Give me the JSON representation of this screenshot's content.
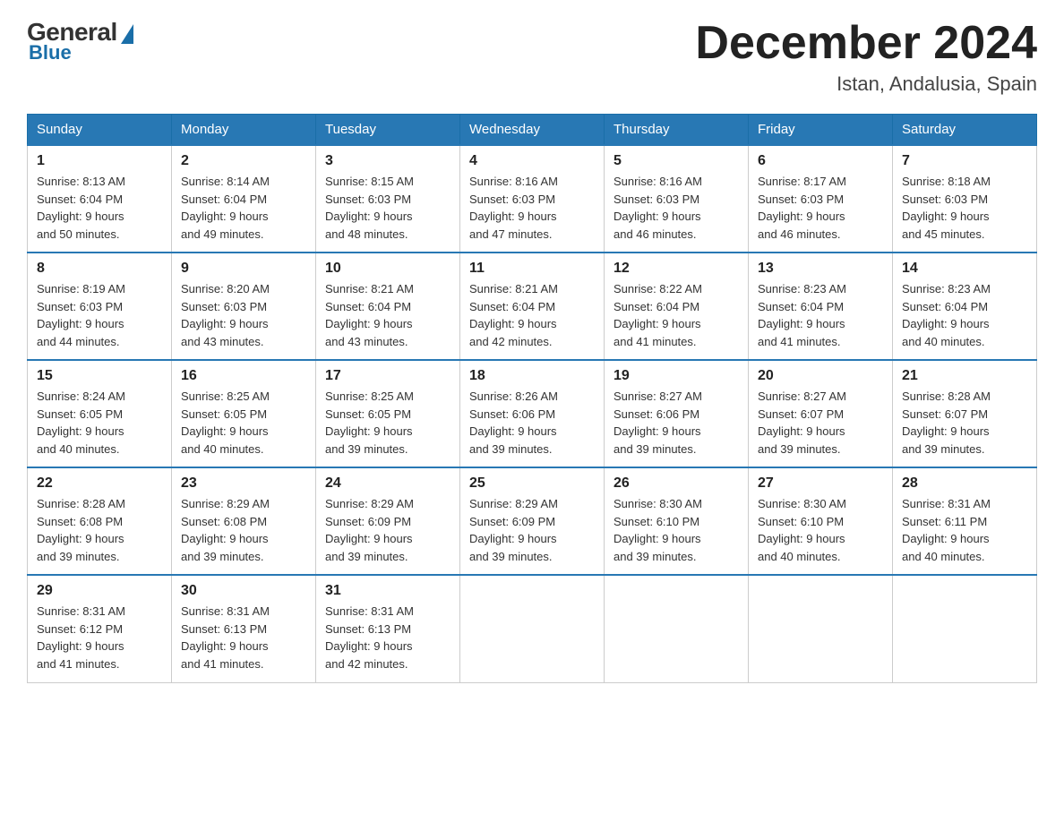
{
  "logo": {
    "general": "General",
    "blue": "Blue"
  },
  "title": {
    "month": "December 2024",
    "location": "Istan, Andalusia, Spain"
  },
  "headers": [
    "Sunday",
    "Monday",
    "Tuesday",
    "Wednesday",
    "Thursday",
    "Friday",
    "Saturday"
  ],
  "weeks": [
    [
      {
        "day": "1",
        "sunrise": "8:13 AM",
        "sunset": "6:04 PM",
        "daylight": "9 hours and 50 minutes."
      },
      {
        "day": "2",
        "sunrise": "8:14 AM",
        "sunset": "6:04 PM",
        "daylight": "9 hours and 49 minutes."
      },
      {
        "day": "3",
        "sunrise": "8:15 AM",
        "sunset": "6:03 PM",
        "daylight": "9 hours and 48 minutes."
      },
      {
        "day": "4",
        "sunrise": "8:16 AM",
        "sunset": "6:03 PM",
        "daylight": "9 hours and 47 minutes."
      },
      {
        "day": "5",
        "sunrise": "8:16 AM",
        "sunset": "6:03 PM",
        "daylight": "9 hours and 46 minutes."
      },
      {
        "day": "6",
        "sunrise": "8:17 AM",
        "sunset": "6:03 PM",
        "daylight": "9 hours and 46 minutes."
      },
      {
        "day": "7",
        "sunrise": "8:18 AM",
        "sunset": "6:03 PM",
        "daylight": "9 hours and 45 minutes."
      }
    ],
    [
      {
        "day": "8",
        "sunrise": "8:19 AM",
        "sunset": "6:03 PM",
        "daylight": "9 hours and 44 minutes."
      },
      {
        "day": "9",
        "sunrise": "8:20 AM",
        "sunset": "6:03 PM",
        "daylight": "9 hours and 43 minutes."
      },
      {
        "day": "10",
        "sunrise": "8:21 AM",
        "sunset": "6:04 PM",
        "daylight": "9 hours and 43 minutes."
      },
      {
        "day": "11",
        "sunrise": "8:21 AM",
        "sunset": "6:04 PM",
        "daylight": "9 hours and 42 minutes."
      },
      {
        "day": "12",
        "sunrise": "8:22 AM",
        "sunset": "6:04 PM",
        "daylight": "9 hours and 41 minutes."
      },
      {
        "day": "13",
        "sunrise": "8:23 AM",
        "sunset": "6:04 PM",
        "daylight": "9 hours and 41 minutes."
      },
      {
        "day": "14",
        "sunrise": "8:23 AM",
        "sunset": "6:04 PM",
        "daylight": "9 hours and 40 minutes."
      }
    ],
    [
      {
        "day": "15",
        "sunrise": "8:24 AM",
        "sunset": "6:05 PM",
        "daylight": "9 hours and 40 minutes."
      },
      {
        "day": "16",
        "sunrise": "8:25 AM",
        "sunset": "6:05 PM",
        "daylight": "9 hours and 40 minutes."
      },
      {
        "day": "17",
        "sunrise": "8:25 AM",
        "sunset": "6:05 PM",
        "daylight": "9 hours and 39 minutes."
      },
      {
        "day": "18",
        "sunrise": "8:26 AM",
        "sunset": "6:06 PM",
        "daylight": "9 hours and 39 minutes."
      },
      {
        "day": "19",
        "sunrise": "8:27 AM",
        "sunset": "6:06 PM",
        "daylight": "9 hours and 39 minutes."
      },
      {
        "day": "20",
        "sunrise": "8:27 AM",
        "sunset": "6:07 PM",
        "daylight": "9 hours and 39 minutes."
      },
      {
        "day": "21",
        "sunrise": "8:28 AM",
        "sunset": "6:07 PM",
        "daylight": "9 hours and 39 minutes."
      }
    ],
    [
      {
        "day": "22",
        "sunrise": "8:28 AM",
        "sunset": "6:08 PM",
        "daylight": "9 hours and 39 minutes."
      },
      {
        "day": "23",
        "sunrise": "8:29 AM",
        "sunset": "6:08 PM",
        "daylight": "9 hours and 39 minutes."
      },
      {
        "day": "24",
        "sunrise": "8:29 AM",
        "sunset": "6:09 PM",
        "daylight": "9 hours and 39 minutes."
      },
      {
        "day": "25",
        "sunrise": "8:29 AM",
        "sunset": "6:09 PM",
        "daylight": "9 hours and 39 minutes."
      },
      {
        "day": "26",
        "sunrise": "8:30 AM",
        "sunset": "6:10 PM",
        "daylight": "9 hours and 39 minutes."
      },
      {
        "day": "27",
        "sunrise": "8:30 AM",
        "sunset": "6:10 PM",
        "daylight": "9 hours and 40 minutes."
      },
      {
        "day": "28",
        "sunrise": "8:31 AM",
        "sunset": "6:11 PM",
        "daylight": "9 hours and 40 minutes."
      }
    ],
    [
      {
        "day": "29",
        "sunrise": "8:31 AM",
        "sunset": "6:12 PM",
        "daylight": "9 hours and 41 minutes."
      },
      {
        "day": "30",
        "sunrise": "8:31 AM",
        "sunset": "6:13 PM",
        "daylight": "9 hours and 41 minutes."
      },
      {
        "day": "31",
        "sunrise": "8:31 AM",
        "sunset": "6:13 PM",
        "daylight": "9 hours and 42 minutes."
      },
      null,
      null,
      null,
      null
    ]
  ]
}
